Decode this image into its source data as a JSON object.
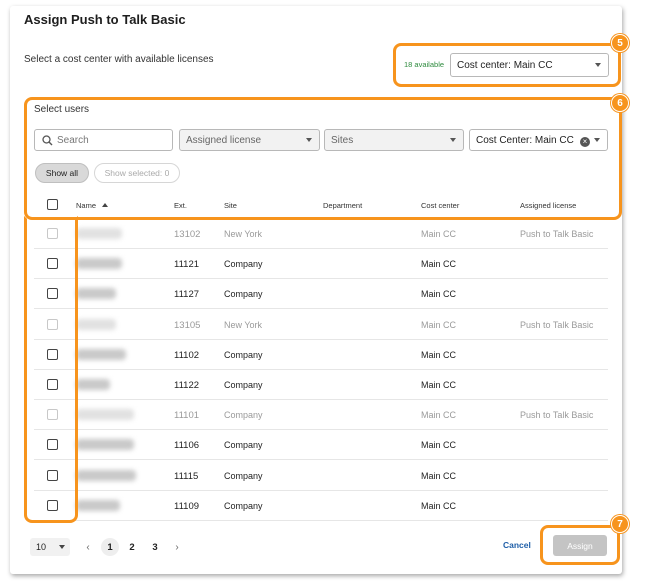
{
  "dialog": {
    "title": "Assign Push to Talk Basic",
    "cost_center_prompt": "Select a cost center with available licenses",
    "available_text": "18 available",
    "cost_center_select": "Cost center: Main CC"
  },
  "users_section": {
    "label": "Select users",
    "search_placeholder": "Search",
    "filter_license": "Assigned license",
    "filter_sites": "Sites",
    "filter_cost_center": "Cost Center: Main CC",
    "show_all": "Show all",
    "show_selected": "Show selected: 0"
  },
  "table": {
    "columns": [
      "Name",
      "Ext.",
      "Site",
      "Department",
      "Cost center",
      "Assigned license"
    ],
    "rows": [
      {
        "ext": "13102",
        "site": "New York",
        "department": "",
        "cost_center": "Main CC",
        "license": "Push to Talk Basic",
        "disabled": true
      },
      {
        "ext": "11121",
        "site": "Company",
        "department": "",
        "cost_center": "Main CC",
        "license": "",
        "disabled": false
      },
      {
        "ext": "11127",
        "site": "Company",
        "department": "",
        "cost_center": "Main CC",
        "license": "",
        "disabled": false
      },
      {
        "ext": "13105",
        "site": "New York",
        "department": "",
        "cost_center": "Main CC",
        "license": "Push to Talk Basic",
        "disabled": true
      },
      {
        "ext": "11102",
        "site": "Company",
        "department": "",
        "cost_center": "Main CC",
        "license": "",
        "disabled": false
      },
      {
        "ext": "11122",
        "site": "Company",
        "department": "",
        "cost_center": "Main CC",
        "license": "",
        "disabled": false
      },
      {
        "ext": "11101",
        "site": "Company",
        "department": "",
        "cost_center": "Main CC",
        "license": "Push to Talk Basic",
        "disabled": true
      },
      {
        "ext": "11106",
        "site": "Company",
        "department": "",
        "cost_center": "Main CC",
        "license": "",
        "disabled": false
      },
      {
        "ext": "11115",
        "site": "Company",
        "department": "",
        "cost_center": "Main CC",
        "license": "",
        "disabled": false
      },
      {
        "ext": "11109",
        "site": "Company",
        "department": "",
        "cost_center": "Main CC",
        "license": "",
        "disabled": false
      }
    ]
  },
  "pagination": {
    "page_size": "10",
    "pages": [
      "1",
      "2",
      "3"
    ],
    "current": "1"
  },
  "footer": {
    "cancel": "Cancel",
    "assign": "Assign"
  },
  "callouts": {
    "cost_center": "5",
    "users": "6",
    "assign": "7"
  },
  "colors": {
    "callout": "#f7941d",
    "available": "#2e8b3e",
    "link": "#1f5fa8"
  }
}
